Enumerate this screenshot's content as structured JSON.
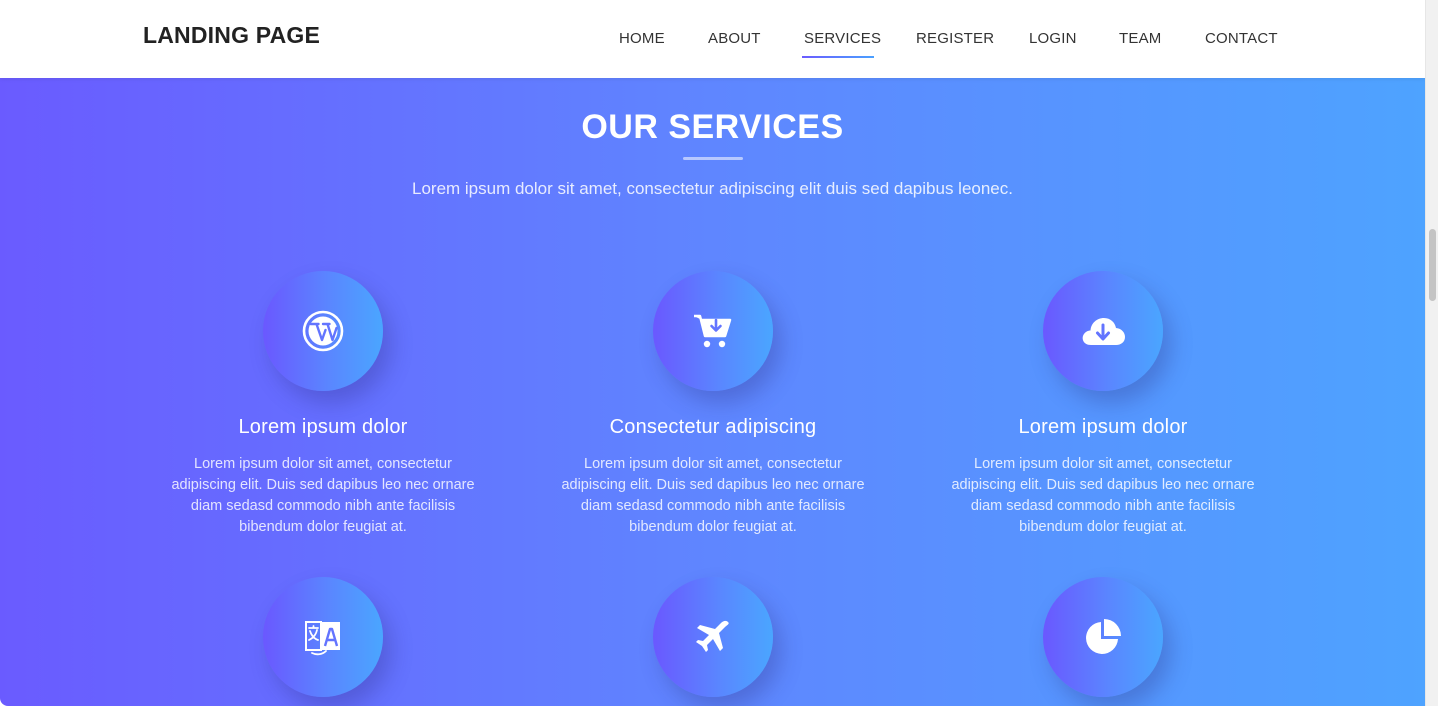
{
  "brand": "LANDING PAGE",
  "nav": [
    {
      "label": "HOME"
    },
    {
      "label": "ABOUT"
    },
    {
      "label": "SERVICES",
      "active": true
    },
    {
      "label": "REGISTER"
    },
    {
      "label": "LOGIN"
    },
    {
      "label": "TEAM"
    },
    {
      "label": "CONTACT"
    }
  ],
  "section": {
    "title": "OUR SERVICES",
    "subtitle": "Lorem ipsum dolor sit amet, consectetur adipiscing elit duis sed dapibus leonec."
  },
  "services": [
    {
      "icon": "wordpress-icon",
      "title": "Lorem ipsum dolor",
      "text": "Lorem ipsum dolor sit amet, consectetur adipiscing elit. Duis sed dapibus leo nec ornare diam sedasd commodo nibh ante facilisis bibendum dolor feugiat at."
    },
    {
      "icon": "cart-download-icon",
      "title": "Consectetur adipiscing",
      "text": "Lorem ipsum dolor sit amet, consectetur adipiscing elit. Duis sed dapibus leo nec ornare diam sedasd commodo nibh ante facilisis bibendum dolor feugiat at."
    },
    {
      "icon": "cloud-download-icon",
      "title": "Lorem ipsum dolor",
      "text": "Lorem ipsum dolor sit amet, consectetur adipiscing elit. Duis sed dapibus leo nec ornare diam sedasd commodo nibh ante facilisis bibendum dolor feugiat at."
    },
    {
      "icon": "language-icon"
    },
    {
      "icon": "plane-icon"
    },
    {
      "icon": "pie-chart-icon"
    }
  ],
  "colors": {
    "gradient_start": "#6a5bff",
    "gradient_end": "#4ea3ff",
    "nav_text": "#333333",
    "brand_text": "#222222"
  }
}
